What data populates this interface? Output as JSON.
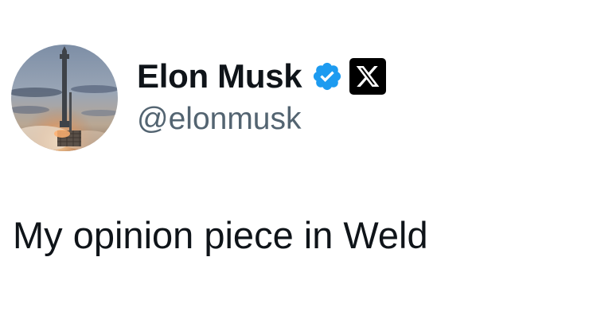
{
  "author": {
    "display_name": "Elon Musk",
    "handle": "@elonmusk",
    "verified": true,
    "avatar_icon": "starship-launch-avatar",
    "badge_icon": "x-logo-icon",
    "verified_color": "#1d9bf0"
  },
  "tweet": {
    "text": "My opinion piece in Weld"
  },
  "colors": {
    "text_primary": "#0f1419",
    "text_secondary": "#536471",
    "background": "#ffffff"
  }
}
